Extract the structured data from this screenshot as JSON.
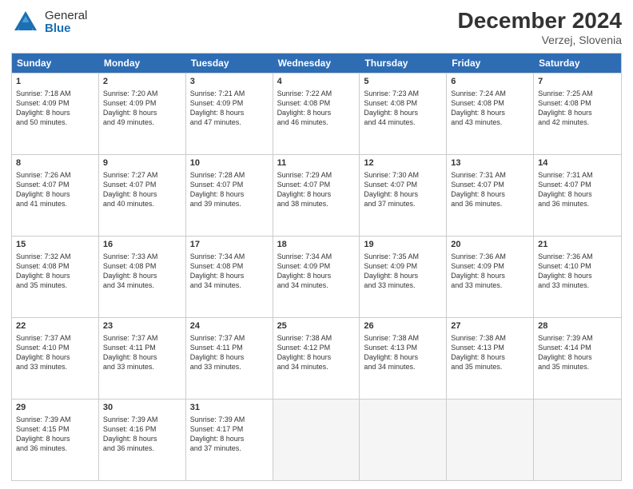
{
  "logo": {
    "general": "General",
    "blue": "Blue"
  },
  "title": {
    "month": "December 2024",
    "location": "Verzej, Slovenia"
  },
  "header_days": [
    "Sunday",
    "Monday",
    "Tuesday",
    "Wednesday",
    "Thursday",
    "Friday",
    "Saturday"
  ],
  "rows": [
    [
      {
        "day": "1",
        "sr": "Sunrise: 7:18 AM",
        "ss": "Sunset: 4:09 PM",
        "dl": "Daylight: 8 hours and 50 minutes."
      },
      {
        "day": "2",
        "sr": "Sunrise: 7:20 AM",
        "ss": "Sunset: 4:09 PM",
        "dl": "Daylight: 8 hours and 49 minutes."
      },
      {
        "day": "3",
        "sr": "Sunrise: 7:21 AM",
        "ss": "Sunset: 4:09 PM",
        "dl": "Daylight: 8 hours and 47 minutes."
      },
      {
        "day": "4",
        "sr": "Sunrise: 7:22 AM",
        "ss": "Sunset: 4:08 PM",
        "dl": "Daylight: 8 hours and 46 minutes."
      },
      {
        "day": "5",
        "sr": "Sunrise: 7:23 AM",
        "ss": "Sunset: 4:08 PM",
        "dl": "Daylight: 8 hours and 44 minutes."
      },
      {
        "day": "6",
        "sr": "Sunrise: 7:24 AM",
        "ss": "Sunset: 4:08 PM",
        "dl": "Daylight: 8 hours and 43 minutes."
      },
      {
        "day": "7",
        "sr": "Sunrise: 7:25 AM",
        "ss": "Sunset: 4:08 PM",
        "dl": "Daylight: 8 hours and 42 minutes."
      }
    ],
    [
      {
        "day": "8",
        "sr": "Sunrise: 7:26 AM",
        "ss": "Sunset: 4:07 PM",
        "dl": "Daylight: 8 hours and 41 minutes."
      },
      {
        "day": "9",
        "sr": "Sunrise: 7:27 AM",
        "ss": "Sunset: 4:07 PM",
        "dl": "Daylight: 8 hours and 40 minutes."
      },
      {
        "day": "10",
        "sr": "Sunrise: 7:28 AM",
        "ss": "Sunset: 4:07 PM",
        "dl": "Daylight: 8 hours and 39 minutes."
      },
      {
        "day": "11",
        "sr": "Sunrise: 7:29 AM",
        "ss": "Sunset: 4:07 PM",
        "dl": "Daylight: 8 hours and 38 minutes."
      },
      {
        "day": "12",
        "sr": "Sunrise: 7:30 AM",
        "ss": "Sunset: 4:07 PM",
        "dl": "Daylight: 8 hours and 37 minutes."
      },
      {
        "day": "13",
        "sr": "Sunrise: 7:31 AM",
        "ss": "Sunset: 4:07 PM",
        "dl": "Daylight: 8 hours and 36 minutes."
      },
      {
        "day": "14",
        "sr": "Sunrise: 7:31 AM",
        "ss": "Sunset: 4:07 PM",
        "dl": "Daylight: 8 hours and 36 minutes."
      }
    ],
    [
      {
        "day": "15",
        "sr": "Sunrise: 7:32 AM",
        "ss": "Sunset: 4:08 PM",
        "dl": "Daylight: 8 hours and 35 minutes."
      },
      {
        "day": "16",
        "sr": "Sunrise: 7:33 AM",
        "ss": "Sunset: 4:08 PM",
        "dl": "Daylight: 8 hours and 34 minutes."
      },
      {
        "day": "17",
        "sr": "Sunrise: 7:34 AM",
        "ss": "Sunset: 4:08 PM",
        "dl": "Daylight: 8 hours and 34 minutes."
      },
      {
        "day": "18",
        "sr": "Sunrise: 7:34 AM",
        "ss": "Sunset: 4:09 PM",
        "dl": "Daylight: 8 hours and 34 minutes."
      },
      {
        "day": "19",
        "sr": "Sunrise: 7:35 AM",
        "ss": "Sunset: 4:09 PM",
        "dl": "Daylight: 8 hours and 33 minutes."
      },
      {
        "day": "20",
        "sr": "Sunrise: 7:36 AM",
        "ss": "Sunset: 4:09 PM",
        "dl": "Daylight: 8 hours and 33 minutes."
      },
      {
        "day": "21",
        "sr": "Sunrise: 7:36 AM",
        "ss": "Sunset: 4:10 PM",
        "dl": "Daylight: 8 hours and 33 minutes."
      }
    ],
    [
      {
        "day": "22",
        "sr": "Sunrise: 7:37 AM",
        "ss": "Sunset: 4:10 PM",
        "dl": "Daylight: 8 hours and 33 minutes."
      },
      {
        "day": "23",
        "sr": "Sunrise: 7:37 AM",
        "ss": "Sunset: 4:11 PM",
        "dl": "Daylight: 8 hours and 33 minutes."
      },
      {
        "day": "24",
        "sr": "Sunrise: 7:37 AM",
        "ss": "Sunset: 4:11 PM",
        "dl": "Daylight: 8 hours and 33 minutes."
      },
      {
        "day": "25",
        "sr": "Sunrise: 7:38 AM",
        "ss": "Sunset: 4:12 PM",
        "dl": "Daylight: 8 hours and 34 minutes."
      },
      {
        "day": "26",
        "sr": "Sunrise: 7:38 AM",
        "ss": "Sunset: 4:13 PM",
        "dl": "Daylight: 8 hours and 34 minutes."
      },
      {
        "day": "27",
        "sr": "Sunrise: 7:38 AM",
        "ss": "Sunset: 4:13 PM",
        "dl": "Daylight: 8 hours and 35 minutes."
      },
      {
        "day": "28",
        "sr": "Sunrise: 7:39 AM",
        "ss": "Sunset: 4:14 PM",
        "dl": "Daylight: 8 hours and 35 minutes."
      }
    ],
    [
      {
        "day": "29",
        "sr": "Sunrise: 7:39 AM",
        "ss": "Sunset: 4:15 PM",
        "dl": "Daylight: 8 hours and 36 minutes."
      },
      {
        "day": "30",
        "sr": "Sunrise: 7:39 AM",
        "ss": "Sunset: 4:16 PM",
        "dl": "Daylight: 8 hours and 36 minutes."
      },
      {
        "day": "31",
        "sr": "Sunrise: 7:39 AM",
        "ss": "Sunset: 4:17 PM",
        "dl": "Daylight: 8 hours and 37 minutes."
      },
      null,
      null,
      null,
      null
    ]
  ]
}
